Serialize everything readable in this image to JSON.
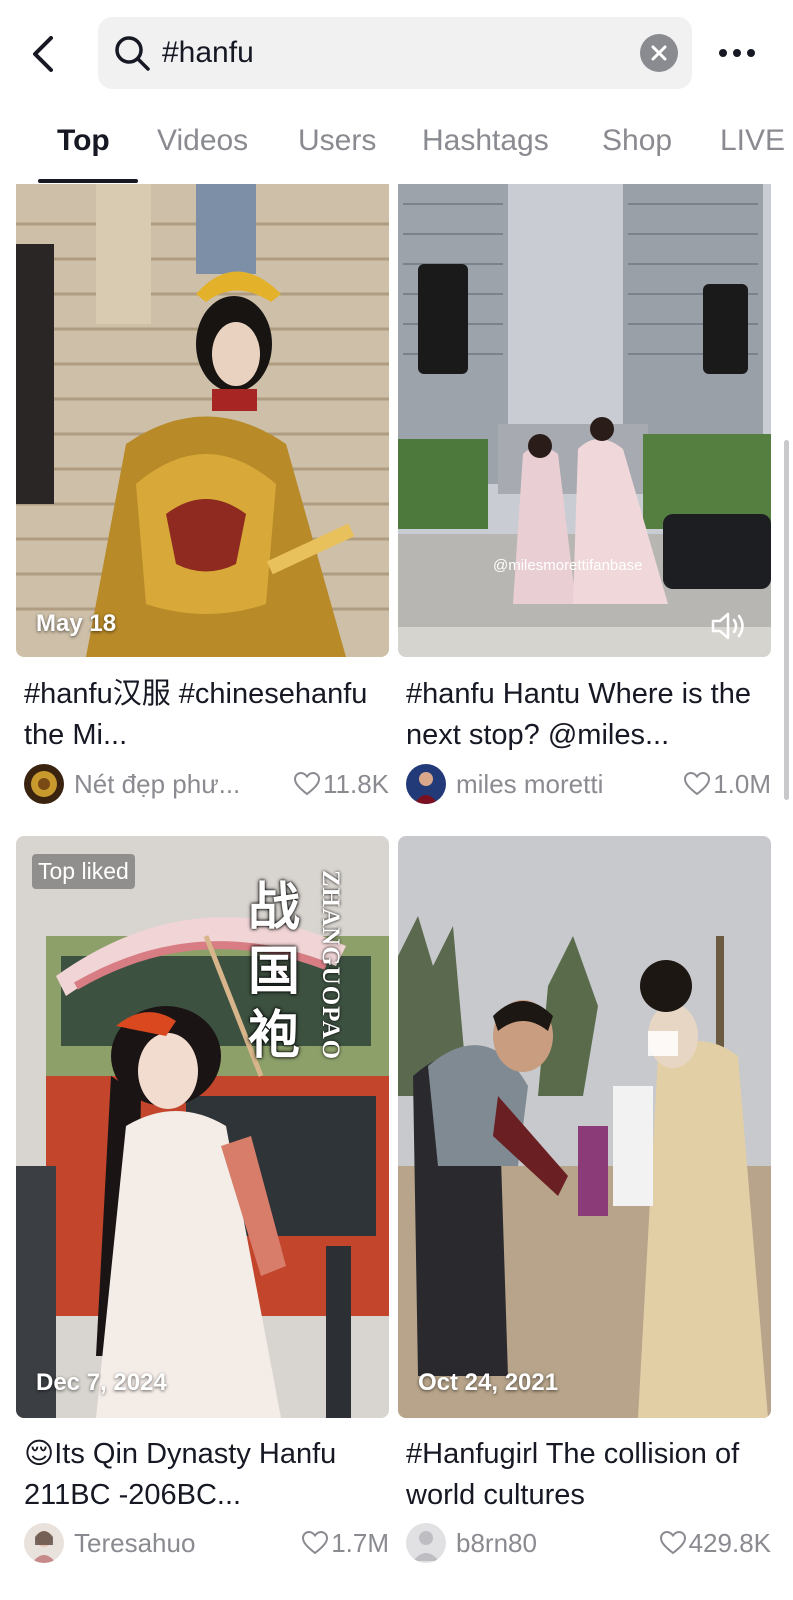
{
  "search": {
    "query": "#hanfu"
  },
  "tabs": [
    "Top",
    "Videos",
    "Users",
    "Hashtags",
    "Shop",
    "LIVE"
  ],
  "icons": {
    "back": "chevron-left-icon",
    "search": "search-icon",
    "clear": "close-icon",
    "more": "more-horizontal-icon",
    "like": "heart-outline-icon",
    "sound": "speaker-icon"
  },
  "videos": [
    {
      "date": "May 18",
      "caption": "#hanfu汉服 #chinesehanfu the Mi...",
      "author": "Nét đẹp phư...",
      "likes": "11.8K"
    },
    {
      "date": "",
      "caption": "#hanfu Hantu Where is the next stop? @miles...",
      "author": "miles moretti",
      "likes": "1.0M",
      "watermark": "@milesmorettifanbase"
    },
    {
      "date": "Dec 7, 2024",
      "caption": "😌Its Qin Dynasty Hanfu 211BC -206BC...",
      "author": "Teresahuo",
      "likes": "1.7M",
      "badge": "Top liked",
      "overlay_cn": "战国袍",
      "overlay_en": "ZHANGUOPAO"
    },
    {
      "date": "Oct 24, 2021",
      "caption": "#Hanfugirl The collision of world cultures",
      "author": "b8rn80",
      "likes": "429.8K"
    }
  ]
}
